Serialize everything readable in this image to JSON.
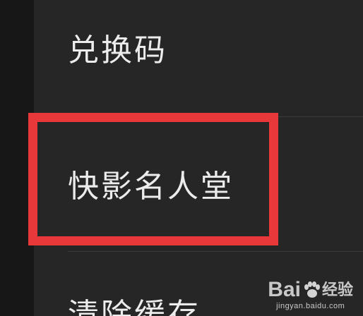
{
  "menu": {
    "items": [
      {
        "label": "兑换码"
      },
      {
        "label": "快影名人堂"
      },
      {
        "label": "清除缓存"
      }
    ]
  },
  "highlight": {
    "color": "#e8383a",
    "target": "快影名人堂"
  },
  "watermark": {
    "brand_left": "Bai",
    "brand_right": "经验",
    "url": "jingyan.baidu.com"
  },
  "colors": {
    "background": "#262626",
    "text": "#ececec",
    "highlight": "#e8383a"
  }
}
